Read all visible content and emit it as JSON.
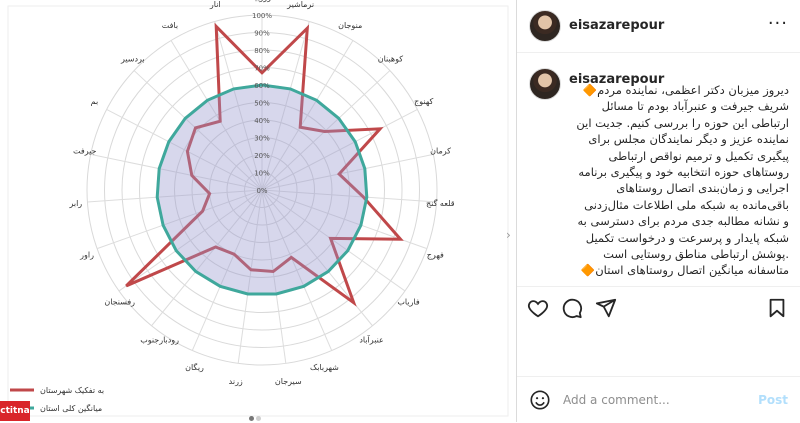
{
  "post": {
    "username": "eisazarepour",
    "caption": "دیروز میزبان دکتر اعظمی، نماینده مردم🔶\nشریف جیرفت و عنبرآباد بودم تا مسائل\nارتباطی این حوزه را بررسی کنیم. جدیت این\nنماینده عزیز و دیگر نمایندگان مجلس برای\nپیگیری تکمیل و ترمیم نواقص ارتباطی\nروستاهای حوزه انتخابیه خود و پیگیری برنامه\nاجرایی و زمان‌بندی اتصال روستاهای\nباقی‌مانده به شبکه ملی اطلاعات مثال‌زدنی\nو نشانه مطالبه جدی مردم برای دسترسی به\nشبکه پایدار و پرسرعت و درخواست تکمیل\n.پوشش ارتباطی مناطق روستایی است\nمتاسفانه میانگین اتصال روستاهای استان🔶"
  },
  "actions": {
    "like_icon": "heart-icon",
    "comment_icon": "comment-icon",
    "share_icon": "paper-plane-icon",
    "save_icon": "bookmark-icon"
  },
  "comment": {
    "placeholder": "Add a comment...",
    "post_label": "Post"
  },
  "watermark": "ctitna",
  "chart_data": {
    "type": "radar",
    "categories": [
      "ارزوییه",
      "نرماشیر",
      "منوجان",
      "کوهبنان",
      "کهنوج",
      "کرمان",
      "قلعه گنج",
      "فهرج",
      "فارياب",
      "عنبرآباد",
      "شهربابک",
      "سیرجان",
      "زرند",
      "ریگان",
      "رودبارجنوب",
      "رفسنجان",
      "راور",
      "رابر",
      "جیرفت",
      "بم",
      "بردسیر",
      "بافت",
      "انار"
    ],
    "rlabels": [
      "0%",
      "10%",
      "20%",
      "30%",
      "40%",
      "50%",
      "60%",
      "70%",
      "80%",
      "90%",
      "100%"
    ],
    "series": [
      {
        "name": "به تفکیک شهرستان",
        "color": "#c0484a",
        "values": [
          0.67,
          0.96,
          0.42,
          0.49,
          0.76,
          0.45,
          0.58,
          0.84,
          0.48,
          0.83,
          0.42,
          0.47,
          0.46,
          0.4,
          0.42,
          0.95,
          0.36,
          0.3,
          0.41,
          0.48,
          0.52,
          0.46,
          0.97
        ]
      },
      {
        "name": "میانگین کلی استان",
        "color": "#3fa89c",
        "values": [
          0.6,
          0.6,
          0.6,
          0.6,
          0.6,
          0.6,
          0.6,
          0.6,
          0.6,
          0.6,
          0.6,
          0.6,
          0.6,
          0.6,
          0.6,
          0.6,
          0.6,
          0.6,
          0.6,
          0.6,
          0.6,
          0.6,
          0.6
        ]
      }
    ],
    "rlim": [
      0,
      1
    ],
    "legend_position": "bottom-left"
  }
}
